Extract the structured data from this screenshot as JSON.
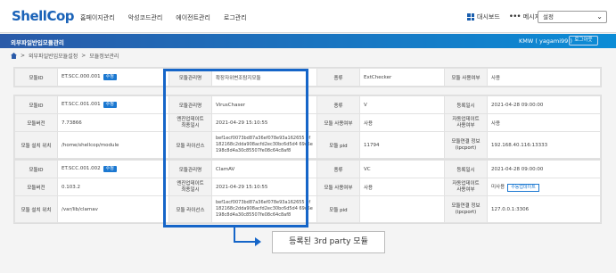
{
  "header": {
    "logo": "ShellCop",
    "nav": [
      "홈페이지관리",
      "악성코드관리",
      "에이전트관리",
      "로그관리"
    ],
    "dashboard": "대시보드",
    "message": "메시지",
    "setting": "설정"
  },
  "bar": {
    "title": "외부파일반입모듈관리",
    "user": "KMW ( yagami99 )",
    "logout": "로그아웃"
  },
  "breadcrumb": [
    "외부파일반입모듈설정",
    "모듈정보관리"
  ],
  "labels": {
    "module_id": "모듈ID",
    "module_name": "모듈관리명",
    "type": "종류",
    "use": "모듈 사용여부",
    "version": "모듈버전",
    "engine_update": "엔진업데이트\n최종일시",
    "module_use": "모듈 사용여부",
    "auto_update": "자동업데이트\n사용여부",
    "install_path": "모듈 설치 위치",
    "license": "모듈 라이선스",
    "pid": "모듈 pid",
    "conn": "모듈연결 정보\n(ipcport)",
    "reg_date": "등록일시",
    "edit": "수정"
  },
  "modules": [
    {
      "id": "ET.SCC.000.001",
      "name": "확장자위변조탐지모듈",
      "type": "ExtChecker",
      "use": "사용"
    },
    {
      "id": "ET.SCC.001.001",
      "name": "VirusChaser",
      "type": "V",
      "reg_date": "2021-04-28 09:00:00",
      "version": "7.73866",
      "engine_update": "2021-04-29 15:10:55",
      "module_use": "사용",
      "auto_update": "사용",
      "install_path": "/home/shellcop/module",
      "license": "bef1ecf0073bd87a36ef078e93a162655 4f182168c2dda908acfd2ec30bc6d5d4 69c5e198c8d4a30c85507fe08c64c8af8",
      "pid": "11794",
      "conn": "192.168.40.116:13333"
    },
    {
      "id": "ET.SCC.001.002",
      "name": "ClamAV",
      "type": "VC",
      "reg_date": "2021-04-28 09:00:00",
      "version": "0.103.2",
      "engine_update": "2021-04-29 15:10:55",
      "module_use": "사용",
      "auto_update": "미사용",
      "auto_update_btn": "수동업데이트",
      "install_path": "/var/lib/clamav",
      "license": "bef1ecf0073bd87a36ef078e93a162655 4f182168c2dda908acfd2ec30bc6d5d4 69c5e198c8d4a30c85507fe08c64c8af8",
      "pid": "",
      "conn": "127.0.0.1:3306"
    }
  ],
  "callout": "등록된 3rd party 모듈",
  "colors": {
    "accent": "#1565c8",
    "bar_start": "#2a5aa8",
    "bar_end": "#0b8cd6"
  }
}
